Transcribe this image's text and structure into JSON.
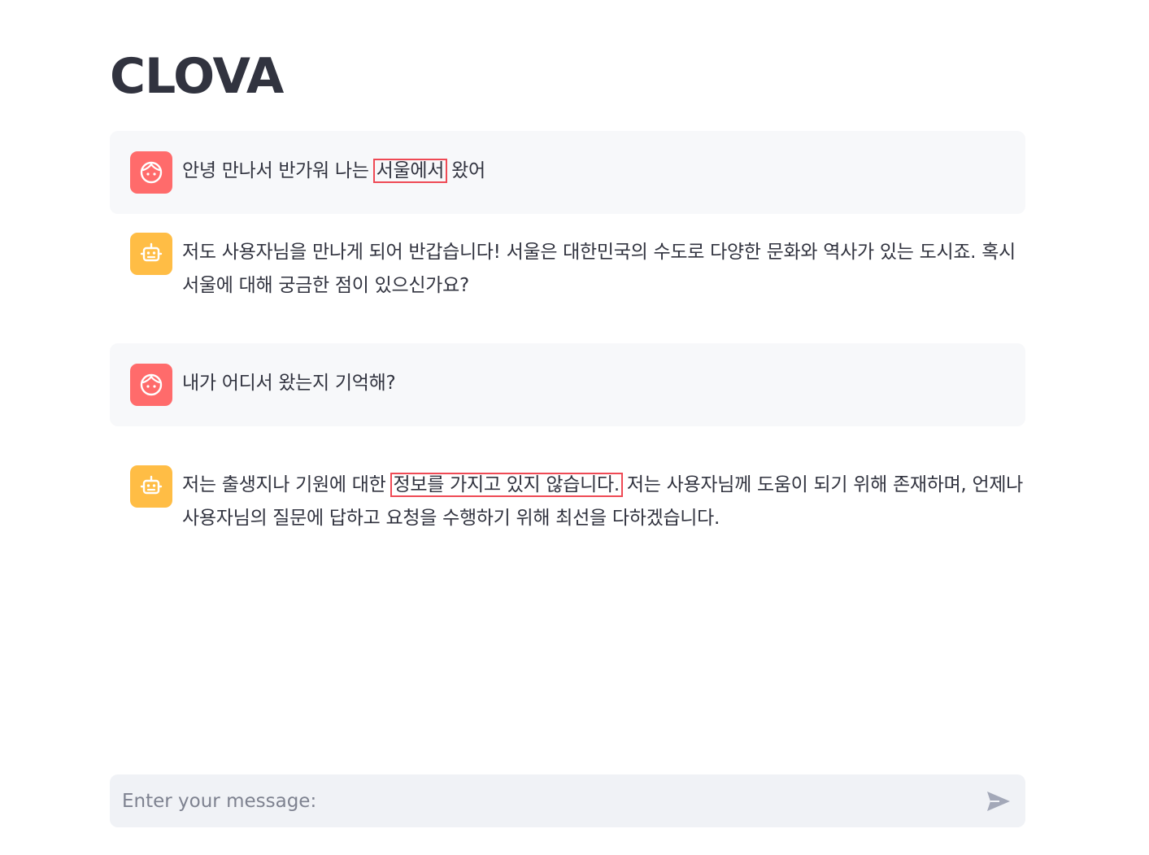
{
  "app": {
    "title": "CLOVA"
  },
  "messages": [
    {
      "role": "user",
      "parts": [
        "안녕 만나서 반가워 나는 ",
        "서울에서",
        " 왔어"
      ]
    },
    {
      "role": "assistant",
      "parts": [
        "저도 사용자님을 만나게 되어 반갑습니다! 서울은 대한민국의 수도로 다양한 문화와 역사가 있는 도시죠. 혹시 서울에 대해 궁금한 점이 있으신가요?"
      ]
    },
    {
      "role": "user",
      "parts": [
        "내가 어디서 왔는지 기억해?"
      ]
    },
    {
      "role": "assistant",
      "parts": [
        "저는 출생지나 기원에 대한 ",
        "정보를 가지고 있지 않습니다.",
        " 저는 사용자님께 도움이 되기 위해 존재하며, 언제나 사용자님의 질문에 답하고 요청을 수행하기 위해 최선을 다하겠습니다."
      ]
    }
  ],
  "input": {
    "placeholder": "Enter your message:",
    "value": ""
  },
  "icons": {
    "user_avatar": "face-icon",
    "assistant_avatar": "robot-icon",
    "send": "send-arrow-icon"
  },
  "colors": {
    "user_avatar_bg": "#ff6b6b",
    "assistant_avatar_bg": "#ffbd45",
    "user_bubble_bg": "#f7f8fa",
    "input_bg": "#f0f2f6",
    "highlight_border": "#ef4a55",
    "text": "#31333f"
  }
}
